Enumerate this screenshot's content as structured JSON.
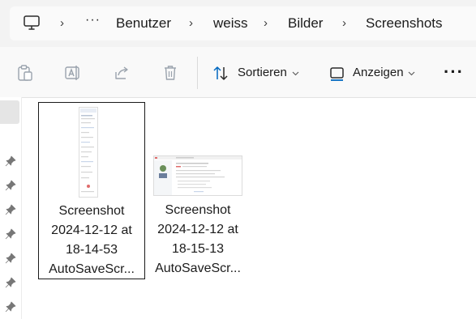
{
  "address_bar": {
    "crumbs": [
      "Benutzer",
      "weiss",
      "Bilder",
      "Screenshots"
    ],
    "separator": "›",
    "overflow": "···"
  },
  "toolbar": {
    "sort_label": "Sortieren",
    "view_label": "Anzeigen",
    "more": "···"
  },
  "files": [
    {
      "name_lines": [
        "Screenshot",
        "2024-12-12 at",
        "18-14-53",
        "AutoSaveScr..."
      ],
      "selected": true,
      "orientation": "portrait"
    },
    {
      "name_lines": [
        "Screenshot",
        "2024-12-12 at",
        "18-15-13",
        "AutoSaveScr..."
      ],
      "selected": false,
      "orientation": "landscape"
    }
  ],
  "colors": {
    "accent": "#0067c0",
    "toolbar_bg": "#f9f9f9",
    "address_bg": "#f3f3f3",
    "disabled_icon": "#9aa3ad"
  }
}
